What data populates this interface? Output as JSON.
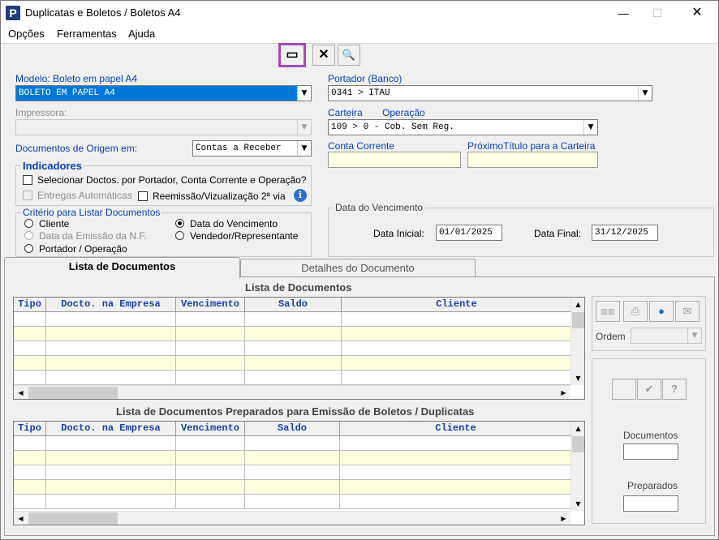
{
  "window": {
    "title": "Duplicatas e Boletos / Boletos A4",
    "app_icon": "P",
    "minimize": "—",
    "maximize": "☐",
    "close": "✕"
  },
  "menu": {
    "items": [
      {
        "label": "Opções"
      },
      {
        "label": "Ferramentas"
      },
      {
        "label": "Ajuda"
      }
    ]
  },
  "toolbar": {
    "window_btn": "▭",
    "cancel_btn": "✕",
    "find_btn": "🔍"
  },
  "form": {
    "modelo_label": "Modelo: Boleto em papel A4",
    "modelo_value": "BOLETO EM PAPEL A4",
    "impressora_label": "Impressora:",
    "impressora_value": "",
    "docs_origem_label": "Documentos de Origem em:",
    "docs_origem_value": "Contas a Receber",
    "portador_label": "Portador (Banco)",
    "portador_value": "0341 > ITAU",
    "carteira_label": "Carteira",
    "operacao_label": "Operação",
    "carteira_value": "109   > 0 - Cob. Sem Reg.",
    "conta_corrente_label": "Conta Corrente",
    "proximo_titulo_label": "PróximoTítulo para a Carteira"
  },
  "indicadores": {
    "title": "Indicadores",
    "selecionar_label": "Selecionar Doctos. por Portador, Conta Corrente  e Operação?",
    "entregas_label": "Entregas Automáticas",
    "reemissao_label": "Reemissão/Vizualização 2ª via"
  },
  "criterio": {
    "title": "Critério para Listar Documentos",
    "cliente": "Cliente",
    "data_emissao": "Data da Emissão da N.F.",
    "portador_operacao": "Portador / Operação",
    "data_vencimento": "Data do Vencimento",
    "vendedor": "Vendedor/Representante"
  },
  "vencimento": {
    "title": "Data do Vencimento",
    "inicial_label": "Data Inicial:",
    "inicial_value": "01/01/2025",
    "final_label": "Data Final:",
    "final_value": "31/12/2025"
  },
  "tabs": [
    {
      "label": "Lista de Documentos"
    },
    {
      "label": "Detalhes do Documento"
    }
  ],
  "lista": {
    "title": "Lista de Documentos",
    "columns": [
      "Tipo",
      "Docto. na Empresa",
      "Vencimento",
      "Saldo",
      "Cliente"
    ]
  },
  "preparados": {
    "title": "Lista de Documentos Preparados para Emissão de Boletos / Duplicatas",
    "columns": [
      "Tipo",
      "Docto. na Empresa",
      "Vencimento",
      "Saldo",
      "Cliente"
    ]
  },
  "side": {
    "ordem_label": "Ordem",
    "ok_btn": "✔",
    "help_btn": "?",
    "documentos_label": "Documentos",
    "preparados_label": "Preparados"
  }
}
